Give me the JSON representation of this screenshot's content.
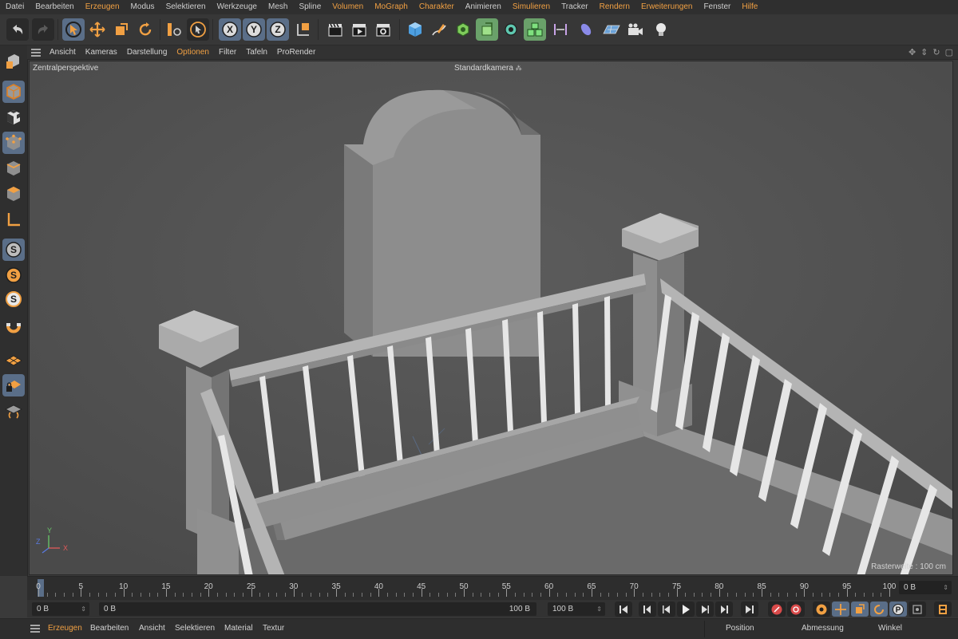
{
  "menubar": {
    "items": [
      {
        "label": "Datei",
        "color": "normal"
      },
      {
        "label": "Bearbeiten",
        "color": "normal"
      },
      {
        "label": "Erzeugen",
        "color": "orange"
      },
      {
        "label": "Modus",
        "color": "normal"
      },
      {
        "label": "Selektieren",
        "color": "normal"
      },
      {
        "label": "Werkzeuge",
        "color": "normal"
      },
      {
        "label": "Mesh",
        "color": "normal"
      },
      {
        "label": "Spline",
        "color": "normal"
      },
      {
        "label": "Volumen",
        "color": "orange"
      },
      {
        "label": "MoGraph",
        "color": "orange"
      },
      {
        "label": "Charakter",
        "color": "orange"
      },
      {
        "label": "Animieren",
        "color": "normal"
      },
      {
        "label": "Simulieren",
        "color": "orange"
      },
      {
        "label": "Tracker",
        "color": "normal"
      },
      {
        "label": "Rendern",
        "color": "orange"
      },
      {
        "label": "Erweiterungen",
        "color": "orange"
      },
      {
        "label": "Fenster",
        "color": "normal"
      },
      {
        "label": "Hilfe",
        "color": "orange"
      }
    ]
  },
  "toolbar": {
    "axis_x": "X",
    "axis_y": "Y",
    "axis_z": "Z"
  },
  "palette": {
    "letter_s": "S"
  },
  "viewport_menu": {
    "items": [
      {
        "label": "Ansicht",
        "color": "normal"
      },
      {
        "label": "Kameras",
        "color": "normal"
      },
      {
        "label": "Darstellung",
        "color": "normal"
      },
      {
        "label": "Optionen",
        "color": "orange"
      },
      {
        "label": "Filter",
        "color": "normal"
      },
      {
        "label": "Tafeln",
        "color": "normal"
      },
      {
        "label": "ProRender",
        "color": "normal"
      }
    ]
  },
  "viewport": {
    "projection_label": "Zentralperspektive",
    "camera_label": "Standardkamera",
    "grid_label": "Rasterweite : 100 cm",
    "axis_labels": {
      "x": "X",
      "y": "Y",
      "z": "Z"
    }
  },
  "timeline": {
    "labels": [
      "0",
      "5",
      "10",
      "15",
      "20",
      "25",
      "30",
      "35",
      "40",
      "45",
      "50",
      "55",
      "60",
      "65",
      "70",
      "75",
      "80",
      "85",
      "90",
      "95",
      "100"
    ],
    "current_frame_field": "0 B"
  },
  "transport": {
    "start_field": "0 B",
    "current_field": "0 B",
    "end_field": "100 B",
    "max_field": "100 B",
    "record_p_label": "P"
  },
  "bottom_bar": {
    "left_items": [
      {
        "label": "Erzeugen",
        "color": "orange"
      },
      {
        "label": "Bearbeiten",
        "color": "normal"
      },
      {
        "label": "Ansicht",
        "color": "normal"
      },
      {
        "label": "Selektieren",
        "color": "normal"
      },
      {
        "label": "Material",
        "color": "normal"
      },
      {
        "label": "Textur",
        "color": "normal"
      }
    ],
    "right_items": [
      {
        "label": "Position"
      },
      {
        "label": "Abmessung"
      },
      {
        "label": "Winkel"
      }
    ]
  },
  "colors": {
    "accent_orange": "#f1a043",
    "selected_blue": "#5a6e88",
    "viewport_bg": "#565656"
  }
}
